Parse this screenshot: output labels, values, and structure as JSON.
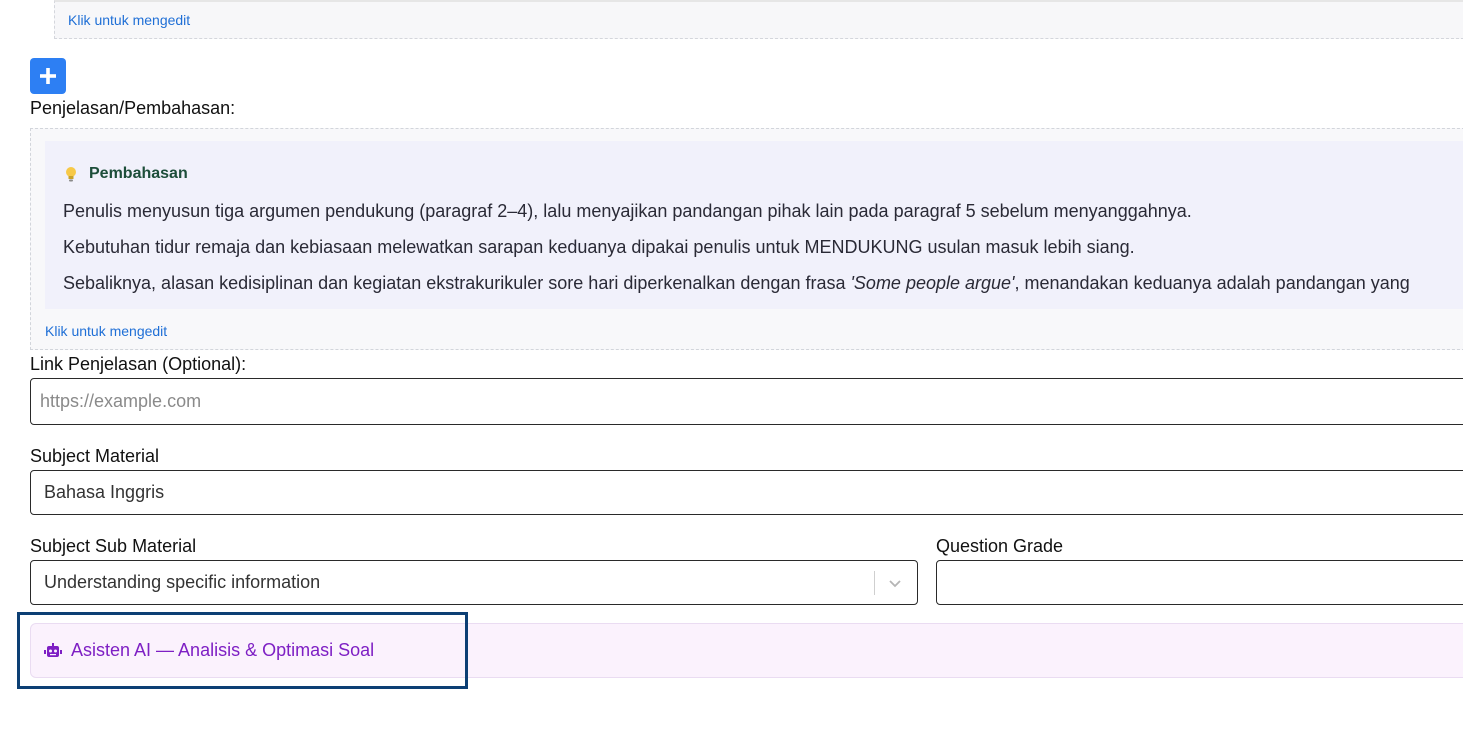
{
  "top_editor": {
    "edit_hint": "Klik untuk mengedit"
  },
  "add_button": {
    "icon": "plus-icon"
  },
  "explanation": {
    "label": "Penjelasan/Pembahasan:",
    "title": "Pembahasan",
    "icon": "lightbulb-icon",
    "paragraphs": [
      "Penulis menyusun tiga argumen pendukung (paragraf 2–4), lalu menyajikan pandangan pihak lain pada paragraf 5 sebelum menyanggahnya.",
      "Kebutuhan tidur remaja dan kebiasaan melewatkan sarapan keduanya dipakai penulis untuk MENDUKUNG usulan masuk lebih siang."
    ],
    "paragraph3": {
      "before": "Sebaliknya, alasan kedisiplinan dan kegiatan ekstrakurikuler sore hari diperkenalkan dengan frasa ",
      "italic": "'Some people argue'",
      "after": ", menandakan keduanya adalah pandangan yang"
    },
    "edit_hint": "Klik untuk mengedit"
  },
  "link": {
    "label": "Link Penjelasan (Optional):",
    "placeholder": "https://example.com",
    "value": ""
  },
  "subject_material": {
    "label": "Subject Material",
    "value": "Bahasa Inggris"
  },
  "subject_sub_material": {
    "label": "Subject Sub Material",
    "value": "Understanding specific information"
  },
  "question_grade": {
    "label": "Question Grade",
    "value": ""
  },
  "ai_assistant": {
    "label": "Asisten AI — Analisis & Optimasi Soal",
    "icon": "robot-icon"
  },
  "colors": {
    "accent": "#2d7ff3",
    "ai_purple": "#7e1fc4",
    "highlight_border": "#0c3f74",
    "title_green": "#1d4e3a"
  }
}
